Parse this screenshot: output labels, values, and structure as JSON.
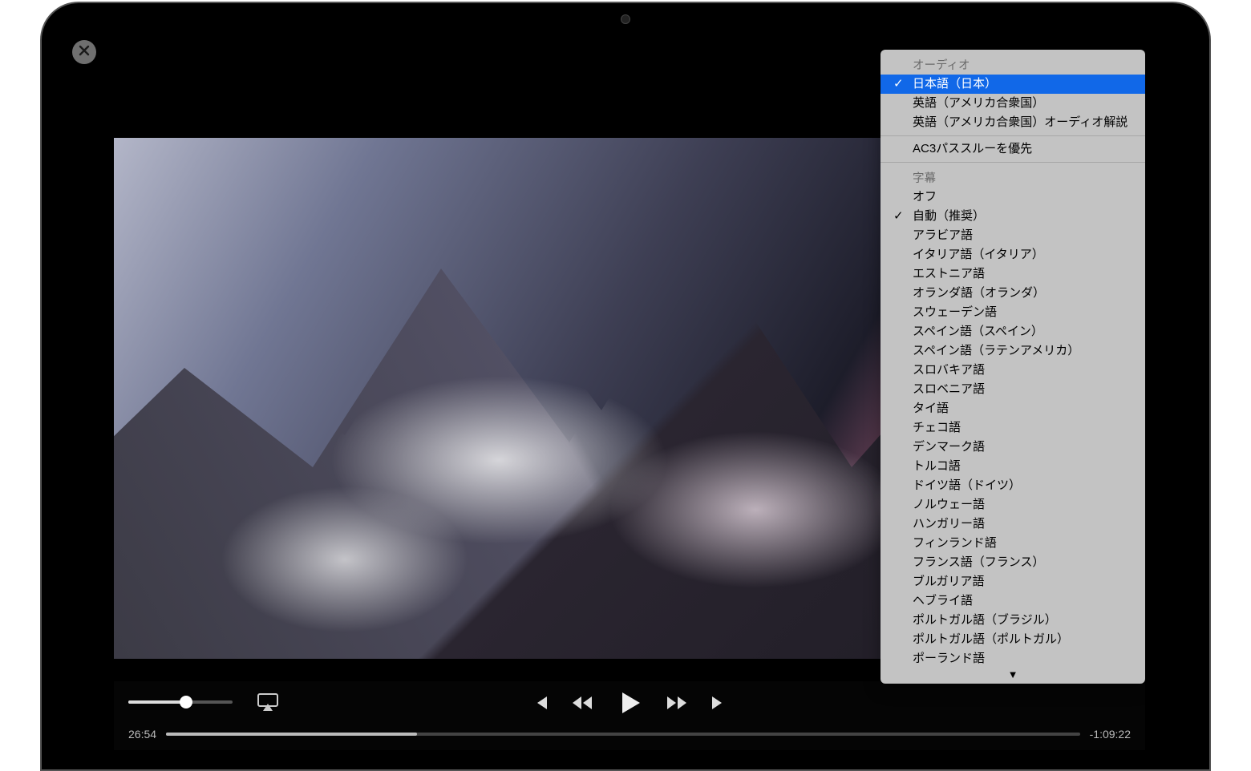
{
  "player": {
    "elapsed": "26:54",
    "remaining": "-1:09:22",
    "progress_pct": 27.5,
    "volume_pct": 55
  },
  "menu": {
    "audio_header": "オーディオ",
    "audio_items": [
      {
        "label": "日本語（日本）",
        "checked": true,
        "highlighted": true
      },
      {
        "label": "英語（アメリカ合衆国）",
        "checked": false,
        "highlighted": false
      },
      {
        "label": "英語（アメリカ合衆国）オーディオ解説",
        "checked": false,
        "highlighted": false
      }
    ],
    "ac3_label": "AC3パススルーを優先",
    "subtitle_header": "字幕",
    "subtitle_items": [
      {
        "label": "オフ",
        "checked": false
      },
      {
        "label": "自動（推奨）",
        "checked": true
      },
      {
        "label": "アラビア語",
        "checked": false
      },
      {
        "label": "イタリア語（イタリア）",
        "checked": false
      },
      {
        "label": "エストニア語",
        "checked": false
      },
      {
        "label": "オランダ語（オランダ）",
        "checked": false
      },
      {
        "label": "スウェーデン語",
        "checked": false
      },
      {
        "label": "スペイン語（スペイン）",
        "checked": false
      },
      {
        "label": "スペイン語（ラテンアメリカ）",
        "checked": false
      },
      {
        "label": "スロバキア語",
        "checked": false
      },
      {
        "label": "スロベニア語",
        "checked": false
      },
      {
        "label": "タイ語",
        "checked": false
      },
      {
        "label": "チェコ語",
        "checked": false
      },
      {
        "label": "デンマーク語",
        "checked": false
      },
      {
        "label": "トルコ語",
        "checked": false
      },
      {
        "label": "ドイツ語（ドイツ）",
        "checked": false
      },
      {
        "label": "ノルウェー語",
        "checked": false
      },
      {
        "label": "ハンガリー語",
        "checked": false
      },
      {
        "label": "フィンランド語",
        "checked": false
      },
      {
        "label": "フランス語（フランス）",
        "checked": false
      },
      {
        "label": "ブルガリア語",
        "checked": false
      },
      {
        "label": "ヘブライ語",
        "checked": false
      },
      {
        "label": "ポルトガル語（ブラジル）",
        "checked": false
      },
      {
        "label": "ポルトガル語（ポルトガル）",
        "checked": false
      },
      {
        "label": "ポーランド語",
        "checked": false
      }
    ],
    "more_indicator": "▼"
  }
}
